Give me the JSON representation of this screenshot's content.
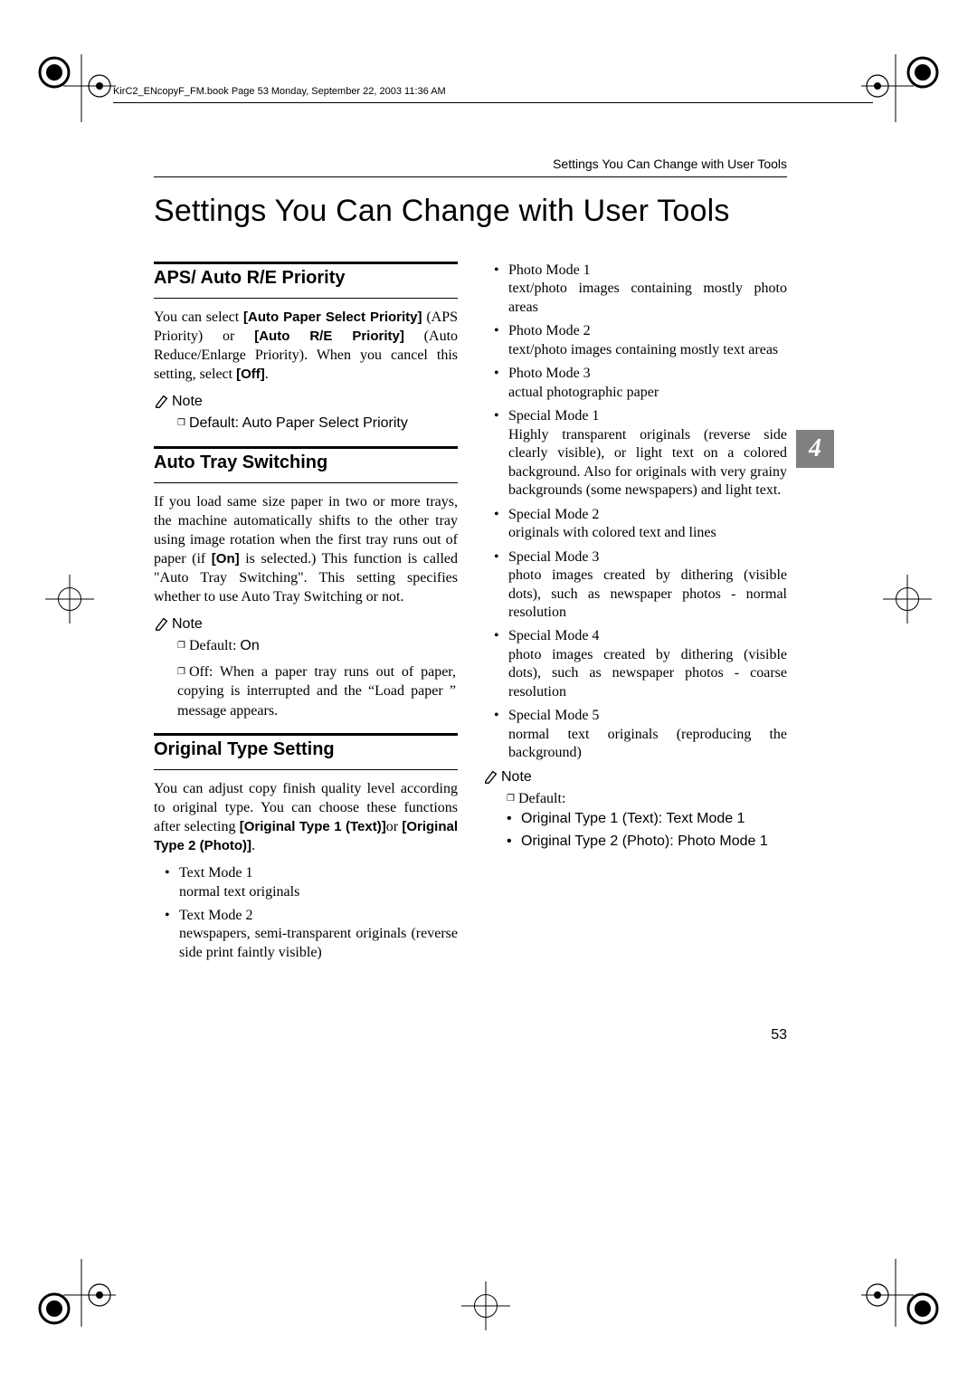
{
  "book_tag": "KirC2_ENcopyF_FM.book  Page 53  Monday, September 22, 2003  11:36 AM",
  "header_right": "Settings You Can Change with User Tools",
  "chapter_title": "Settings You Can Change with User Tools",
  "section_tab": "4",
  "page_number": "53",
  "aps": {
    "heading": "APS/ Auto R/E Priority",
    "body_pre1": "You can select ",
    "bold1": "[Auto Paper Select Priority]",
    "body_mid1": " (APS Priority) or ",
    "bold2": "[Auto R/E Priority]",
    "body_post1": " (Auto Reduce/Enlarge Priority). When you cancel this setting, select ",
    "bold3": "[Off]",
    "body_end1": ".",
    "note_label": "Note",
    "note_body": "Default: Auto Paper Select Priority"
  },
  "ats": {
    "heading": "Auto Tray Switching",
    "body_pre": "If you load same size paper in two or more trays, the machine automatically shifts to the other tray using image rotation when the first tray runs out of paper (if ",
    "bold_on": "[On]",
    "body_post": " is selected.) This function is called \"Auto Tray Switching\". This setting specifies whether to use Auto Tray Switching or not.",
    "note_label": "Note",
    "default_pre": "Default: ",
    "default_sans": "On",
    "off_pre": "Off: When a paper tray runs out of paper, copying is interrupted and the “",
    "off_ui": "Load paper ",
    "off_post": "” message appears."
  },
  "ots": {
    "heading": "Original Type Setting",
    "body_pre": "You can adjust copy finish quality level according to original type. You can choose these functions after selecting ",
    "bold1": "[Original Type 1 (Text)]",
    "body_mid": "or ",
    "bold2": "[Original Type 2 (Photo)]",
    "body_end": ".",
    "modes": [
      {
        "name": "Text Mode 1",
        "desc": "normal text originals"
      },
      {
        "name": "Text Mode 2",
        "desc": "newspapers, semi-transparent originals (reverse side print faintly visible)"
      },
      {
        "name": "Photo Mode 1",
        "desc": "text/photo images containing mostly photo areas"
      },
      {
        "name": "Photo Mode 2",
        "desc": "text/photo images containing mostly text areas"
      },
      {
        "name": "Photo Mode 3",
        "desc": "actual photographic paper"
      },
      {
        "name": "Special Mode 1",
        "desc": "Highly transparent originals (reverse side clearly visible), or light text on a colored background. Also for originals with very grainy backgrounds (some newspapers) and light text."
      },
      {
        "name": "Special Mode 2",
        "desc": "originals with colored text and lines"
      },
      {
        "name": "Special Mode 3",
        "desc": "photo images created by dithering (visible dots), such as newspaper photos - normal resolution"
      },
      {
        "name": "Special Mode 4",
        "desc": "photo images created by dithering (visible dots), such as newspaper photos - coarse resolution"
      },
      {
        "name": "Special Mode 5",
        "desc": "normal text originals (reproducing the background)"
      }
    ],
    "note_label": "Note",
    "note_default": "Default:",
    "note_items": [
      "Original Type 1 (Text): Text Mode 1",
      "Original Type 2 (Photo): Photo Mode 1"
    ]
  }
}
